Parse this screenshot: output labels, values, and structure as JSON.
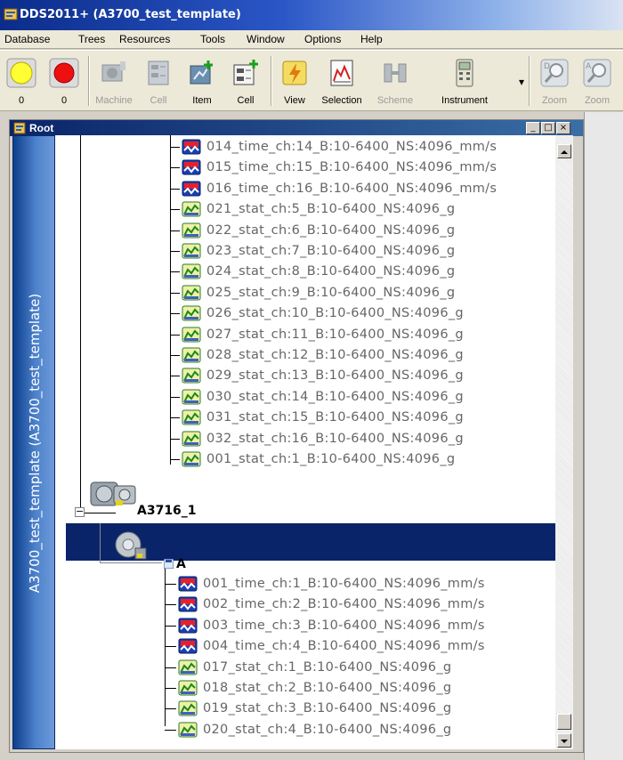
{
  "window": {
    "title": "DDS2011+ (A3700_test_template)"
  },
  "menu": [
    "Database",
    "Trees",
    "Resources",
    "Tools",
    "Window",
    "Options",
    "Help"
  ],
  "toolbar": [
    {
      "label": "0",
      "icon": "yellow-circle-icon",
      "disabled": false
    },
    {
      "label": "0",
      "icon": "red-circle-icon",
      "disabled": false
    },
    {
      "label": "Machine",
      "icon": "machine-icon",
      "disabled": true
    },
    {
      "label": "Cell",
      "icon": "cell-icon",
      "disabled": true
    },
    {
      "label": "Item",
      "icon": "add-item-icon",
      "disabled": false
    },
    {
      "label": "Cell",
      "icon": "add-cell-icon",
      "disabled": false
    },
    {
      "label": "View",
      "icon": "view-icon",
      "disabled": false
    },
    {
      "label": "Selection",
      "icon": "selection-icon",
      "disabled": false
    },
    {
      "label": "Scheme",
      "icon": "scheme-icon",
      "disabled": true
    },
    {
      "label": "Instrument",
      "icon": "instrument-icon",
      "disabled": false
    },
    {
      "label": "Zoom",
      "icon": "zoom-icon",
      "disabled": true
    },
    {
      "label": "Zoom",
      "icon": "zoom-a-icon",
      "disabled": true
    }
  ],
  "child_window": {
    "title": "Root",
    "buttons": [
      "_",
      "□",
      "×"
    ]
  },
  "sideband": {
    "text": "A3700_test_template (A3700_test_template)"
  },
  "tree": {
    "group1": [
      {
        "name": "014_time_ch:14_B:10-6400_NS:4096_mm/s",
        "kind": "time"
      },
      {
        "name": "015_time_ch:15_B:10-6400_NS:4096_mm/s",
        "kind": "time"
      },
      {
        "name": "016_time_ch:16_B:10-6400_NS:4096_mm/s",
        "kind": "time"
      },
      {
        "name": "021_stat_ch:5_B:10-6400_NS:4096_g",
        "kind": "stat"
      },
      {
        "name": "022_stat_ch:6_B:10-6400_NS:4096_g",
        "kind": "stat"
      },
      {
        "name": "023_stat_ch:7_B:10-6400_NS:4096_g",
        "kind": "stat"
      },
      {
        "name": "024_stat_ch:8_B:10-6400_NS:4096_g",
        "kind": "stat"
      },
      {
        "name": "025_stat_ch:9_B:10-6400_NS:4096_g",
        "kind": "stat"
      },
      {
        "name": "026_stat_ch:10_B:10-6400_NS:4096_g",
        "kind": "stat"
      },
      {
        "name": "027_stat_ch:11_B:10-6400_NS:4096_g",
        "kind": "stat"
      },
      {
        "name": "028_stat_ch:12_B:10-6400_NS:4096_g",
        "kind": "stat"
      },
      {
        "name": "029_stat_ch:13_B:10-6400_NS:4096_g",
        "kind": "stat"
      },
      {
        "name": "030_stat_ch:14_B:10-6400_NS:4096_g",
        "kind": "stat"
      },
      {
        "name": "031_stat_ch:15_B:10-6400_NS:4096_g",
        "kind": "stat"
      },
      {
        "name": "032_stat_ch:16_B:10-6400_NS:4096_g",
        "kind": "stat"
      },
      {
        "name": "001_stat_ch:1_B:10-6400_NS:4096_g",
        "kind": "stat"
      }
    ],
    "machine": {
      "name": "A3716_1",
      "expander": "−"
    },
    "point": {
      "name": "A"
    },
    "group2": [
      {
        "name": "001_time_ch:1_B:10-6400_NS:4096_mm/s",
        "kind": "time"
      },
      {
        "name": "002_time_ch:2_B:10-6400_NS:4096_mm/s",
        "kind": "time"
      },
      {
        "name": "003_time_ch:3_B:10-6400_NS:4096_mm/s",
        "kind": "time"
      },
      {
        "name": "004_time_ch:4_B:10-6400_NS:4096_mm/s",
        "kind": "time"
      },
      {
        "name": "017_stat_ch:1_B:10-6400_NS:4096_g",
        "kind": "stat"
      },
      {
        "name": "018_stat_ch:2_B:10-6400_NS:4096_g",
        "kind": "stat"
      },
      {
        "name": "019_stat_ch:3_B:10-6400_NS:4096_g",
        "kind": "stat"
      },
      {
        "name": "020_stat_ch:4_B:10-6400_NS:4096_g",
        "kind": "stat"
      }
    ]
  },
  "colors": {
    "selection": "#0a246a",
    "title": "#0b2c8a",
    "sideband": "#2b63b8"
  }
}
